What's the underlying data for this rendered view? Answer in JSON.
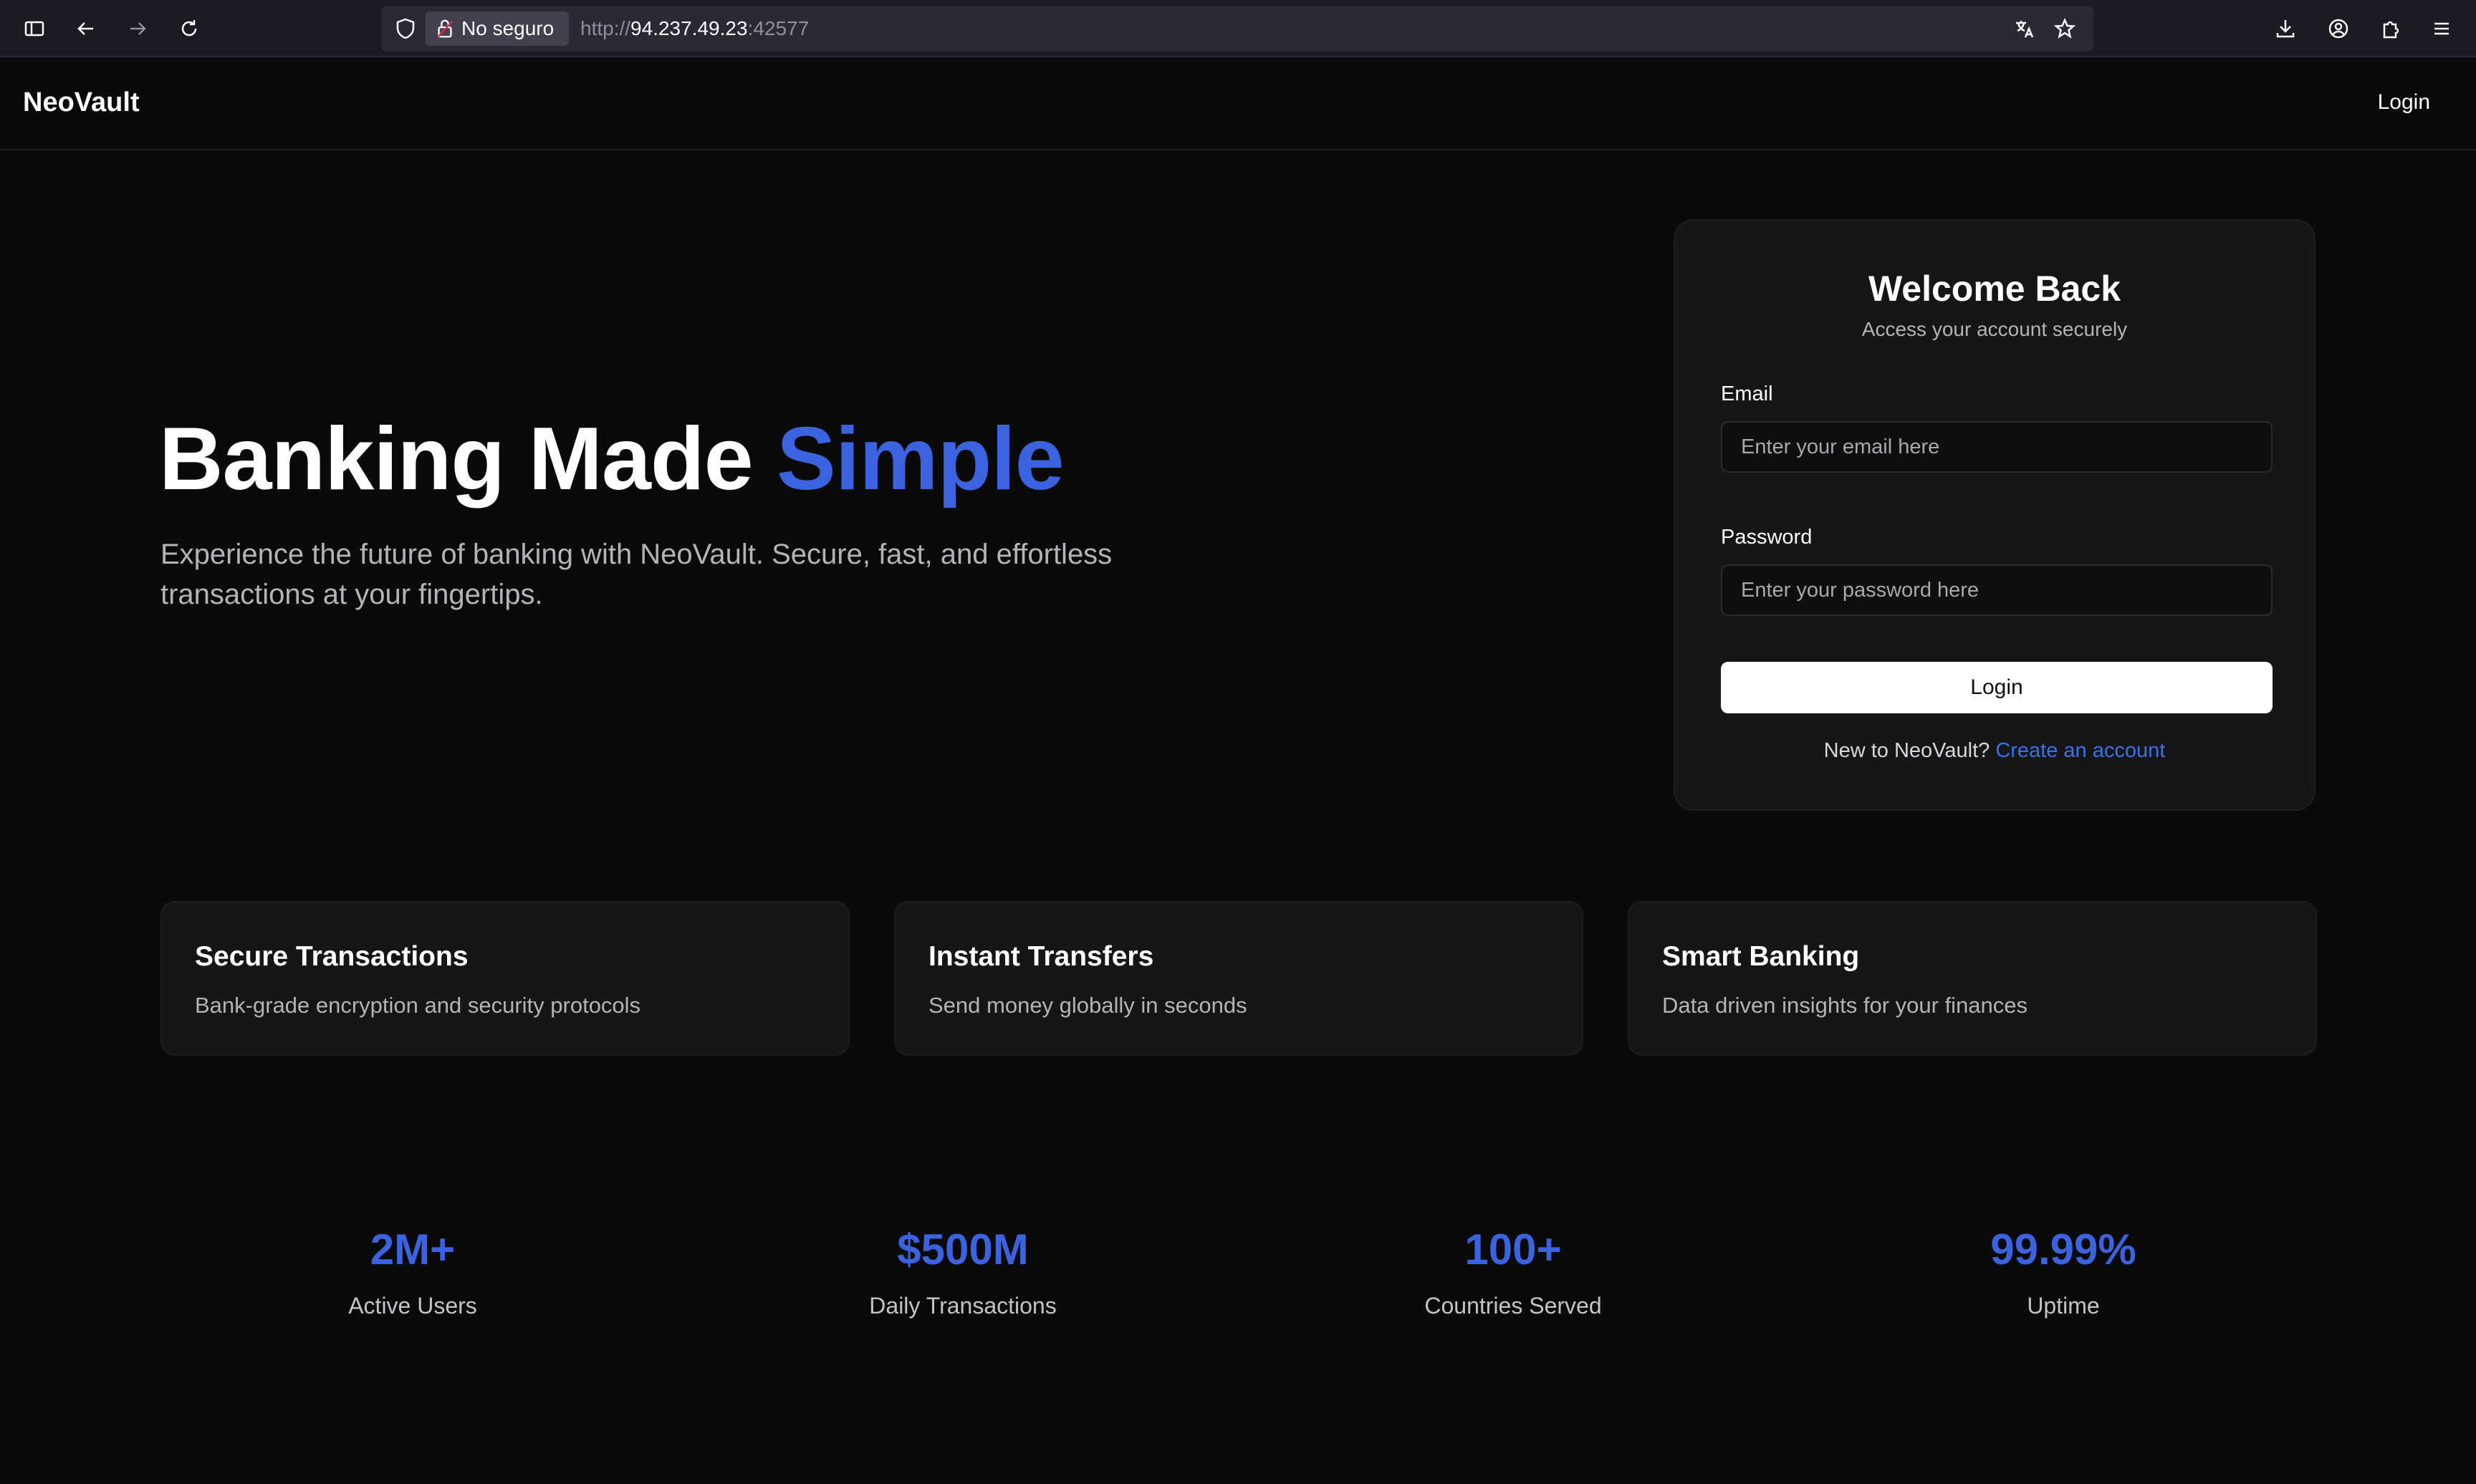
{
  "browser": {
    "security_label": "No seguro",
    "url_scheme": "http://",
    "url_host": "94.237.49.23",
    "url_port": ":42577"
  },
  "header": {
    "brand": "NeoVault",
    "login_link": "Login"
  },
  "hero": {
    "title_main": "Banking Made ",
    "title_accent": "Simple",
    "subtitle": "Experience the future of banking with NeoVault. Secure, fast, and effortless transactions at your fingertips."
  },
  "login_card": {
    "title": "Welcome Back",
    "subtitle": "Access your account securely",
    "email_label": "Email",
    "email_placeholder": "Enter your email here",
    "password_label": "Password",
    "password_placeholder": "Enter your password here",
    "submit_label": "Login",
    "signup_prompt": "New to NeoVault? ",
    "signup_link": "Create an account"
  },
  "features": [
    {
      "title": "Secure Transactions",
      "desc": "Bank-grade encryption and security protocols"
    },
    {
      "title": "Instant Transfers",
      "desc": "Send money globally in seconds"
    },
    {
      "title": "Smart Banking",
      "desc": "Data driven insights for your finances"
    }
  ],
  "stats": [
    {
      "value": "2M+",
      "label": "Active Users"
    },
    {
      "value": "$500M",
      "label": "Daily Transactions"
    },
    {
      "value": "100+",
      "label": "Countries Served"
    },
    {
      "value": "99.99%",
      "label": "Uptime"
    }
  ],
  "colors": {
    "accent": "#3b63e0",
    "link": "#3b72e8",
    "background": "#0a0a0b",
    "card": "#161617"
  }
}
